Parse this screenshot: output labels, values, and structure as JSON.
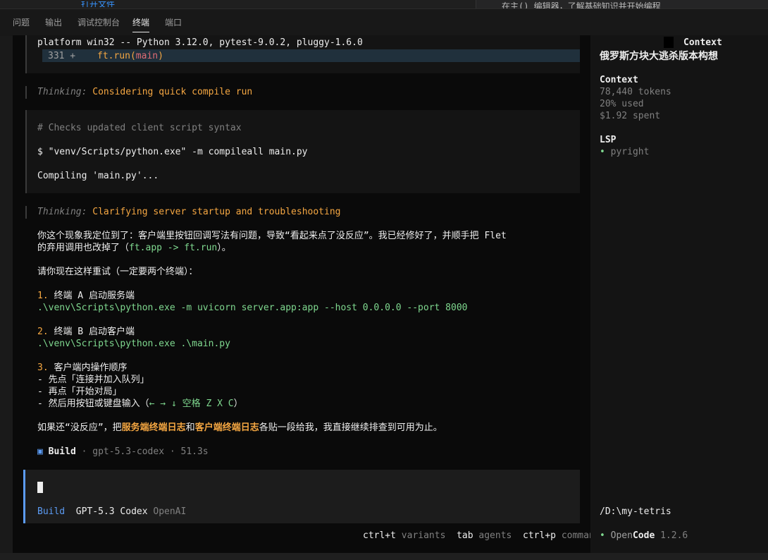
{
  "tabs": [
    {
      "label": "问题"
    },
    {
      "label": "输出"
    },
    {
      "label": "调试控制台"
    },
    {
      "label": "终端"
    },
    {
      "label": "端口"
    }
  ],
  "top_ghost": {
    "left_text": "打开文件",
    "right_text": "在主() 编辑器，了解基础知识并开始编程"
  },
  "transcript": {
    "platform_line": "platform win32 -- Python 3.12.0, pytest-9.0.2, pluggy-1.6.0",
    "diff": {
      "line_no": "331 +",
      "code": "ft.run(",
      "arg": "main",
      "close": ")"
    },
    "thinking1": {
      "prefix": "Thinking:",
      "text": "Considering quick compile run"
    },
    "tool": {
      "comment": "# Checks updated client script syntax",
      "command": "$ \"venv/Scripts/python.exe\" -m compileall main.py",
      "output": "Compiling 'main.py'..."
    },
    "thinking2": {
      "prefix": "Thinking:",
      "text": "Clarifying server startup and troubleshooting"
    },
    "msg_line1": "你这个现象我定位到了：客户端里按钮回调写法有问题，导致“看起来点了没反应”。我已经修好了，并顺手把 Flet",
    "msg_line2a": "的弃用调用也改掉了（",
    "msg_line2_code": "ft.app -> ft.run",
    "msg_line2b": "）。",
    "msg_retry": "请你现在这样重试（一定要两个终端）：",
    "step1_num": "1.",
    "step1_text": " 终端 A 启动服务端",
    "step1_cmd": ".\\venv\\Scripts\\python.exe -m uvicorn server.app:app --host 0.0.0.0 --port 8000",
    "step2_num": "2.",
    "step2_text": " 终端 B 启动客户端",
    "step2_cmd": ".\\venv\\Scripts\\python.exe .\\main.py",
    "step3_num": "3.",
    "step3_text": " 客户端内操作顺序",
    "step3_a": "- 先点「连接并加入队列」",
    "step3_b": "- 再点「开始对局」",
    "step3_c_pre": "- 然后用按钮或键盘输入（",
    "step3_c_keys": "← → ↓ 空格 Z X C",
    "step3_c_post": "）",
    "final_pre": "如果还“没反应”，把",
    "final_hl1": "服务端终端日志",
    "final_mid": "和",
    "final_hl2": "客户端终端日志",
    "final_post": "各贴一段给我，我直接继续排查到可用为止。",
    "build_icon": "▣",
    "build_label": "Build",
    "build_meta": " · gpt-5.3-codex · 51.3s"
  },
  "input": {
    "mode": "Build",
    "model": "GPT-5.3 Codex",
    "provider": "OpenAI"
  },
  "shortcuts": [
    {
      "key": "ctrl+t",
      "label": "variants"
    },
    {
      "key": "tab",
      "label": "agents"
    },
    {
      "key": "ctrl+p",
      "label": "commands"
    }
  ],
  "sidebar": {
    "top_label": "Context",
    "session_title": "俄罗斯方块大逃杀版本构想",
    "context_heading": "Context",
    "tokens": "78,440 tokens",
    "used": "20% used",
    "spent": "$1.92 spent",
    "lsp_heading": "LSP",
    "lsp_item": "pyright",
    "path": "/D:\\my-tetris",
    "brand_open": "Open",
    "brand_code": "Code",
    "version": "1.2.6"
  },
  "colors": {
    "accent_blue": "#5c9cf5",
    "orange": "#f5a742",
    "green": "#7fd88f",
    "background": "#0a0a0a",
    "panel": "#141414"
  }
}
